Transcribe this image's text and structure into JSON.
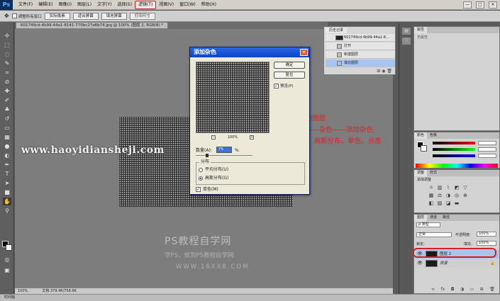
{
  "menubar": {
    "logo": "Ps",
    "items": [
      "文件(F)",
      "编辑(E)",
      "图像(I)",
      "图层(L)",
      "文字(Y)",
      "选择(S)",
      "滤镜(T)",
      "视图(V)",
      "窗口(W)",
      "帮助(H)"
    ],
    "active_index": 6,
    "window_controls": [
      "—",
      "□",
      "✕"
    ]
  },
  "options": {
    "sample_all": "调整所有窗口",
    "btn_actual": "实际像素",
    "btn_fit": "适合屏幕",
    "btn_fill": "填充屏幕",
    "btn_print": "打印尺寸"
  },
  "document": {
    "tab": "601749cd-4b99-44a1-8141-770bc27a6b74.jpg @ 100% (图层 2, RGB/8) *",
    "zoom": "100%",
    "doc_size": "文档:379.4K/758.8K",
    "timeline": "时间轴"
  },
  "watermark": "www.haoyidiansheji.com",
  "tutorial": {
    "title": "PS教程自学网",
    "sub1": "学PS，就到PS教程自学网",
    "sub2": "WWW.16XX8.COM"
  },
  "annotation": {
    "lines": [
      "点击新建的图层",
      "选择滤镜——杂色——添加杂色",
      "数量75%，高斯分布，单色，点击",
      "确定"
    ],
    "color": "#e02020"
  },
  "dialog": {
    "title": "添加杂色",
    "ok": "确定",
    "reset": "复位",
    "preview_label": "预览(P)",
    "zoom": "100%",
    "amount_label": "数量(A):",
    "amount_value": "75",
    "amount_unit": "%",
    "distribution_label": "分布",
    "uniform": "平均分布(U)",
    "gaussian": "高斯分布(G)",
    "monochromatic": "单色(M)"
  },
  "history": {
    "tab": "历史记录",
    "snapshot": "601749cd-4b99-44a1-8...",
    "items": [
      "打开",
      "新建图层",
      "填充图层"
    ],
    "selected_index": 2
  },
  "properties": {
    "tab": "属性",
    "hint": "无属性"
  },
  "color_panel": {
    "tabs": [
      "颜色",
      "色板"
    ]
  },
  "adjustments": {
    "tabs": [
      "调整",
      "样式"
    ],
    "hint": "添加调整"
  },
  "layers": {
    "tabs": [
      "图层",
      "通道",
      "路径"
    ],
    "kind": "ρ 类型",
    "blend": "正常",
    "opacity_label": "不透明度:",
    "opacity": "100%",
    "lock_label": "锁定:",
    "fill_label": "填充:",
    "fill": "100%",
    "items": [
      {
        "name": "图层 2"
      },
      {
        "name": "背景"
      }
    ]
  }
}
